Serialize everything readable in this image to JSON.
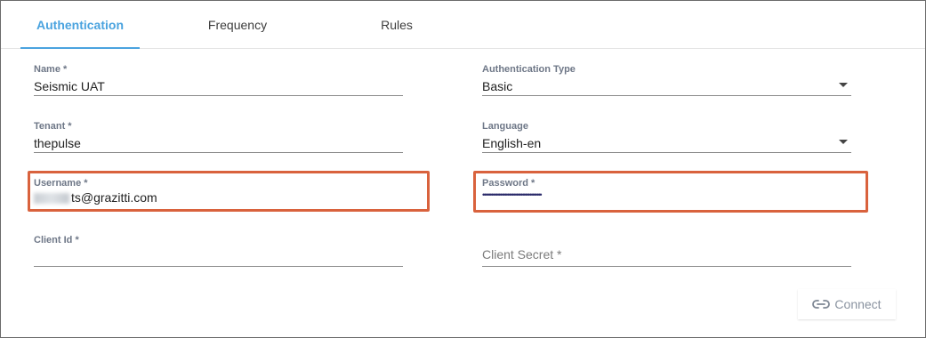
{
  "tabs": [
    {
      "label": "Authentication",
      "active": true
    },
    {
      "label": "Frequency",
      "active": false
    },
    {
      "label": "Rules",
      "active": false
    }
  ],
  "form": {
    "name": {
      "label": "Name *",
      "value": "Seismic UAT"
    },
    "tenant": {
      "label": "Tenant *",
      "value": "thepulse"
    },
    "username": {
      "label": "Username *",
      "value": "ts@grazitti.com"
    },
    "client_id": {
      "label": "Client Id *",
      "value": ""
    },
    "auth_type": {
      "label": "Authentication Type",
      "value": "Basic"
    },
    "language": {
      "label": "Language",
      "value": "English-en"
    },
    "password": {
      "label": "Password *",
      "value": "••••••••••••••••••••••••••••••••••••••••"
    },
    "client_secret": {
      "placeholder": "Client Secret *"
    }
  },
  "actions": {
    "connect_label": "Connect",
    "connect_icon": "link-icon"
  },
  "colors": {
    "accent": "#4aa3df",
    "highlight": "#d9623d"
  }
}
